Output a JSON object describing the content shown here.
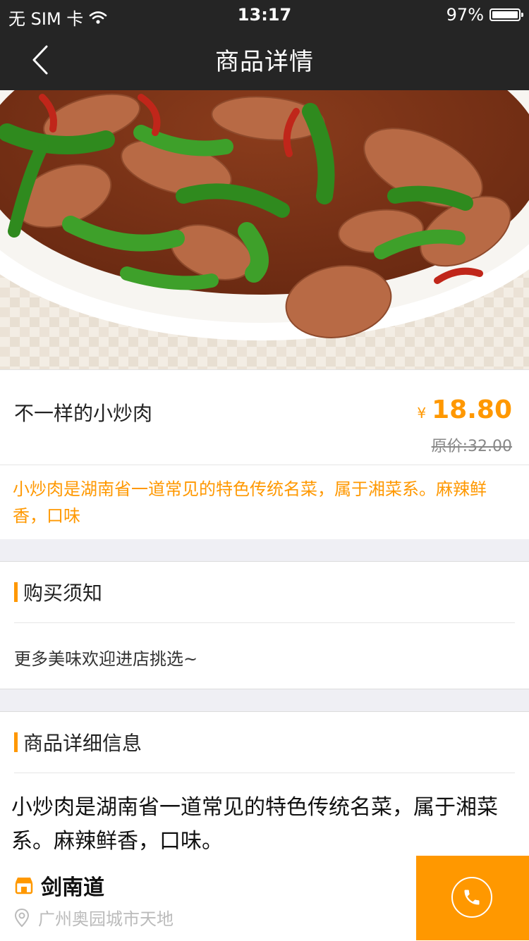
{
  "status_bar": {
    "carrier": "无 SIM 卡",
    "time": "13:17",
    "battery": "97%"
  },
  "nav": {
    "title": "商品详情"
  },
  "product": {
    "name": "不一样的小炒肉",
    "currency": "¥",
    "price": "18.80",
    "original_price": "原价:32.00",
    "short_desc": "小炒肉是湖南省一道常见的特色传统名菜，属于湘菜系。麻辣鲜香，口味"
  },
  "notice": {
    "title": "购买须知",
    "text": "更多美味欢迎进店挑选~"
  },
  "details": {
    "title": "商品详细信息",
    "text": "小炒肉是湖南省一道常见的特色传统名菜，属于湘菜系。麻辣鲜香，口味。",
    "shop_name": "剑南道",
    "address": "广州奥园城市天地"
  },
  "colors": {
    "accent": "#ff9800",
    "nav_bg": "#252525"
  },
  "icons": [
    "wifi-icon",
    "battery-icon",
    "back-icon",
    "shop-icon",
    "location-icon",
    "phone-icon"
  ]
}
